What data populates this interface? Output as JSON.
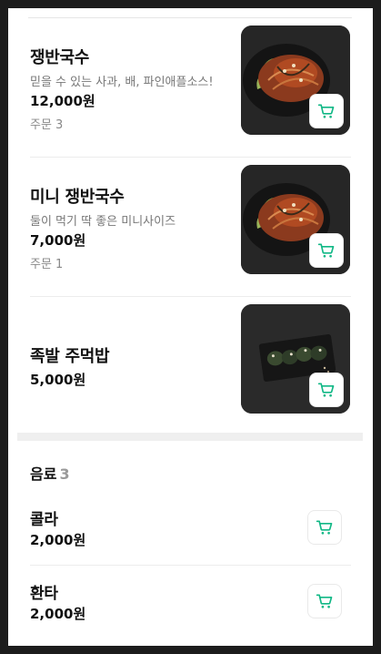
{
  "menu_items": [
    {
      "name": "쟁반국수",
      "description": "믿을 수 있는 사과, 배, 파인애플소스!",
      "price": "12,000원",
      "order": "주문 3"
    },
    {
      "name": "미니 쟁반국수",
      "description": "둘이 먹기 딱 좋은 미니사이즈",
      "price": "7,000원",
      "order": "주문 1"
    },
    {
      "name": "족발 주먹밥",
      "price": "5,000원"
    }
  ],
  "drinks_section": {
    "title": "음료",
    "count": "3",
    "items": [
      {
        "name": "콜라",
        "price": "2,000원"
      },
      {
        "name": "환타",
        "price": "2,000원"
      }
    ]
  },
  "icons": {
    "cart": "shopping-cart-icon"
  },
  "colors": {
    "accent": "#12b886"
  }
}
